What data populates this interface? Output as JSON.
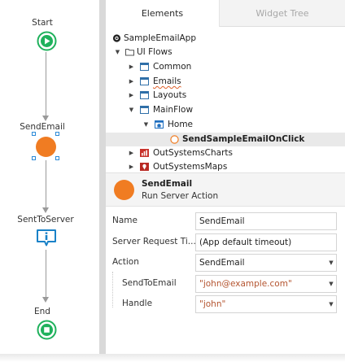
{
  "flow": {
    "nodes": [
      {
        "label": "Start",
        "icon": "start-play-icon"
      },
      {
        "label": "SendEmail",
        "icon": "server-action-circle",
        "color": "#f07c22"
      },
      {
        "label": "SentToServer",
        "icon": "info-message-icon"
      },
      {
        "label": "End",
        "icon": "end-stop-icon"
      }
    ],
    "colors": {
      "accent_green": "#1fb15c",
      "accent_blue": "#1a82c8",
      "selection": "#2b8ad8"
    }
  },
  "tabs": [
    {
      "label": "Elements",
      "active": true
    },
    {
      "label": "Widget Tree",
      "active": false
    }
  ],
  "tree": [
    {
      "label": "SampleEmailApp",
      "icon": "app-icon",
      "expander": ""
    },
    {
      "label": "UI Flows",
      "icon": "folder-icon",
      "expander": "▼"
    },
    {
      "label": "Common",
      "icon": "ui-flow-icon",
      "expander": "▶"
    },
    {
      "label": "Emails",
      "icon": "ui-flow-icon",
      "expander": "▶"
    },
    {
      "label": "Layouts",
      "icon": "ui-flow-icon",
      "expander": "▶"
    },
    {
      "label": "MainFlow",
      "icon": "ui-flow-icon",
      "expander": "▼"
    },
    {
      "label": "Home",
      "icon": "screen-icon",
      "expander": "▼"
    },
    {
      "label": "SendSampleEmailOnClick",
      "icon": "client-action-icon",
      "expander": ""
    },
    {
      "label": "OutSystemsCharts",
      "icon": "module-charts-icon",
      "expander": "▶"
    },
    {
      "label": "OutSystemsMaps",
      "icon": "module-maps-icon",
      "expander": "▶"
    }
  ],
  "selected_element": {
    "name": "SendEmail",
    "type": "Run Server Action"
  },
  "properties": [
    {
      "label": "Name",
      "value": "SendEmail",
      "dropdown": false
    },
    {
      "label": "Server Request Ti...",
      "value": "(App default timeout)",
      "dropdown": false
    },
    {
      "label": "Action",
      "value": "SendEmail",
      "dropdown": true
    },
    {
      "label": "SendToEmail",
      "value": "\"john@example.com\"",
      "dropdown": true
    },
    {
      "label": "Handle",
      "value": "\"john\"",
      "dropdown": true
    }
  ]
}
